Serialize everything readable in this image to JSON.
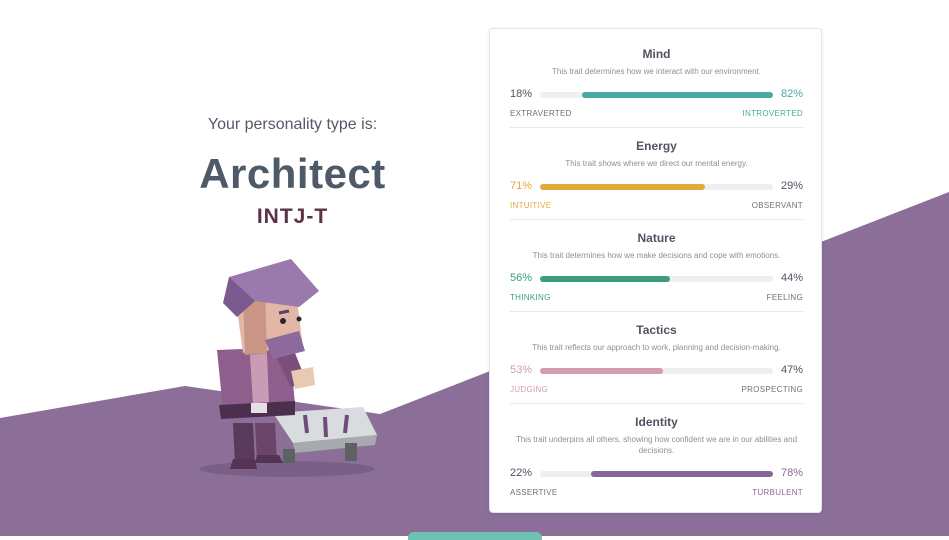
{
  "result": {
    "intro": "Your personality type is:",
    "type_name": "Architect",
    "type_code": "INTJ-T"
  },
  "traits": [
    {
      "title": "Mind",
      "description": "This trait determines how we interact with our environment.",
      "left_pct": "18%",
      "right_pct": "82%",
      "left_label": "EXTRAVERTED",
      "right_label": "INTROVERTED",
      "dominant": "right",
      "value": 82,
      "color": "#4aa9a1"
    },
    {
      "title": "Energy",
      "description": "This trait shows where we direct our mental energy.",
      "left_pct": "71%",
      "right_pct": "29%",
      "left_label": "INTUITIVE",
      "right_label": "OBSERVANT",
      "dominant": "left",
      "value": 71,
      "color": "#e3a93a"
    },
    {
      "title": "Nature",
      "description": "This trait determines how we make decisions and cope with emotions.",
      "left_pct": "56%",
      "right_pct": "44%",
      "left_label": "THINKING",
      "right_label": "FEELING",
      "dominant": "left",
      "value": 56,
      "color": "#3c9d7c"
    },
    {
      "title": "Tactics",
      "description": "This trait reflects our approach to work, planning and decision-making.",
      "left_pct": "53%",
      "right_pct": "47%",
      "left_label": "JUDGING",
      "right_label": "PROSPECTING",
      "dominant": "left",
      "value": 53,
      "color": "#d39cb3"
    },
    {
      "title": "Identity",
      "description": "This trait underpins all others, showing how confident we are in our abilities and decisions.",
      "left_pct": "22%",
      "right_pct": "78%",
      "left_label": "ASSERTIVE",
      "right_label": "TURBULENT",
      "dominant": "right",
      "value": 78,
      "color": "#886798"
    }
  ],
  "colors": {
    "background_shape": "#8b6f99",
    "text_dark": "#4e5461",
    "type_code": "#5a3346"
  },
  "illustration": "architect-character"
}
